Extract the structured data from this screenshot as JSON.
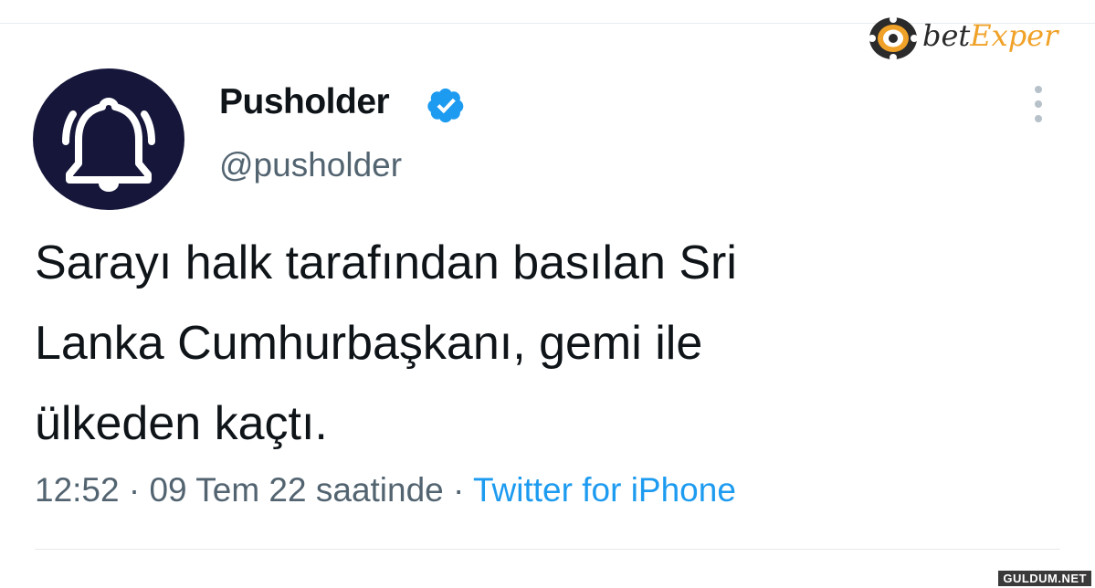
{
  "tweet": {
    "display_name": "Pusholder",
    "handle": "@pusholder",
    "text_lines": [
      "Sarayı halk tarafından basılan Sri",
      "Lanka Cumhurbaşkanı, gemi ile",
      "ülkeden kaçtı."
    ],
    "meta": {
      "time": "12:52",
      "separator": "·",
      "date": "09 Tem 22 saatinde",
      "source": "Twitter for iPhone"
    },
    "verified_icon": "verified-badge-icon",
    "more_icon": "more-vertical-icon",
    "avatar_icon": "bell-icon"
  },
  "overlays": {
    "brand_logo_bet": "bet",
    "brand_logo_exper": "Exper",
    "watermark": "GULDUM.NET"
  },
  "colors": {
    "avatar_bg": "#15163a",
    "verified": "#1d9bf0",
    "link": "#1d9bf0",
    "text": "#0f1419",
    "muted": "#536471",
    "brand_accent": "#f0a228"
  }
}
